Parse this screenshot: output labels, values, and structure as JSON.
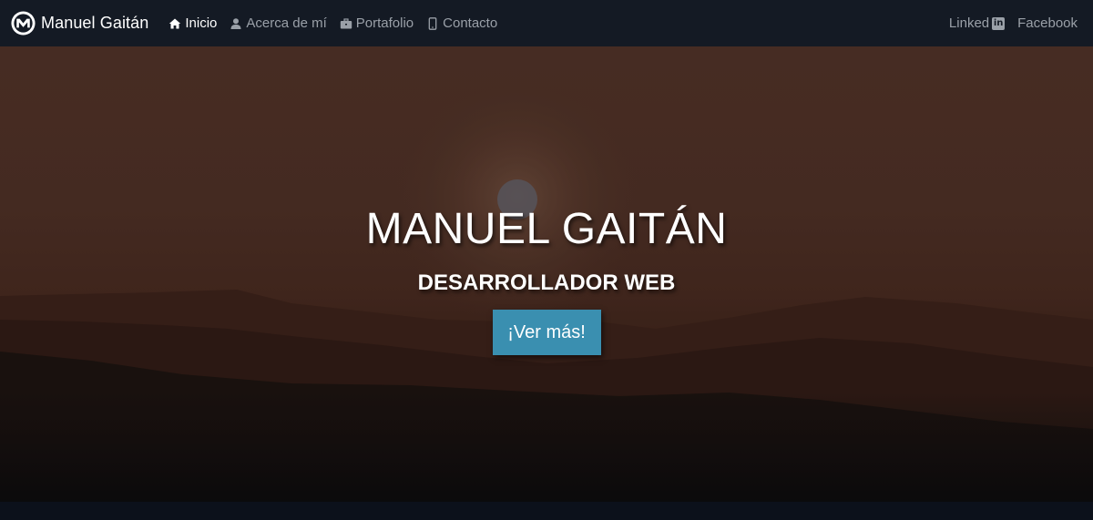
{
  "nav": {
    "brand": "Manuel Gaitán",
    "items": [
      {
        "label": "Inicio",
        "icon": "home-icon",
        "active": true
      },
      {
        "label": "Acerca de mí",
        "icon": "user-icon",
        "active": false
      },
      {
        "label": "Portafolio",
        "icon": "briefcase-icon",
        "active": false
      },
      {
        "label": "Contacto",
        "icon": "mobile-icon",
        "active": false
      }
    ],
    "right": [
      {
        "label": "Linked",
        "badge": "in",
        "icon": "linkedin-icon"
      },
      {
        "label": "Facebook"
      }
    ]
  },
  "hero": {
    "title": "MANUEL GAITÁN",
    "subtitle": "DESARROLLADOR WEB",
    "button": "¡Ver más!"
  },
  "colors": {
    "navbar": "#141a24",
    "accent": "#3a8fb0",
    "nav_text": "#9aa0a8",
    "active_text": "#ffffff"
  }
}
